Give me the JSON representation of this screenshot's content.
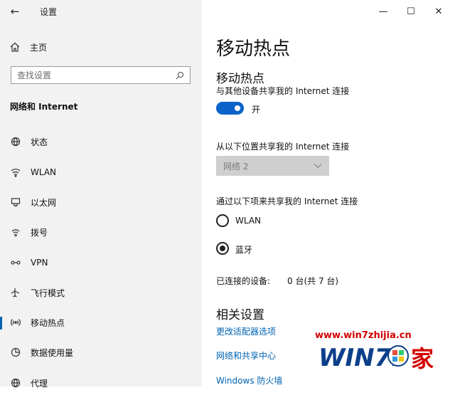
{
  "window": {
    "title": "设置",
    "controls": {
      "minimize": "—",
      "maximize": "☐",
      "close": "✕"
    }
  },
  "sidebar": {
    "home": "主页",
    "search_placeholder": "查找设置",
    "section_title": "网络和 Internet",
    "items": [
      {
        "label": "状态",
        "icon": "globe-icon"
      },
      {
        "label": "WLAN",
        "icon": "wifi-icon"
      },
      {
        "label": "以太网",
        "icon": "ethernet-icon"
      },
      {
        "label": "拨号",
        "icon": "dialup-icon"
      },
      {
        "label": "VPN",
        "icon": "vpn-icon"
      },
      {
        "label": "飞行模式",
        "icon": "airplane-icon"
      },
      {
        "label": "移动热点",
        "icon": "hotspot-icon",
        "active": true
      },
      {
        "label": "数据使用量",
        "icon": "data-usage-icon"
      },
      {
        "label": "代理",
        "icon": "globe-icon"
      }
    ]
  },
  "main": {
    "page_title": "移动热点",
    "hotspot": {
      "heading": "移动热点",
      "share_desc": "与其他设备共享我的 Internet 连接",
      "toggle_state": "开",
      "share_from_label": "从以下位置共享我的 Internet 连接",
      "share_from_value": "网络 2",
      "share_over_label": "通过以下项来共享我的 Internet 连接",
      "options": [
        "WLAN",
        "蓝牙"
      ],
      "selected_option": "蓝牙",
      "connected_label": "已连接的设备:",
      "connected_value": "0 台(共 7 台)"
    },
    "related": {
      "heading": "相关设置",
      "links": [
        "更改适配器选项",
        "网络和共享中心",
        "Windows 防火墙"
      ]
    }
  },
  "watermark": {
    "url": "www.win7zhijia.cn",
    "logo_text_left": "WIN7.",
    "logo_text_right": "家"
  },
  "colors": {
    "accent": "#0063b1",
    "toggle": "#0a63c8",
    "watermark": "#d40000"
  }
}
